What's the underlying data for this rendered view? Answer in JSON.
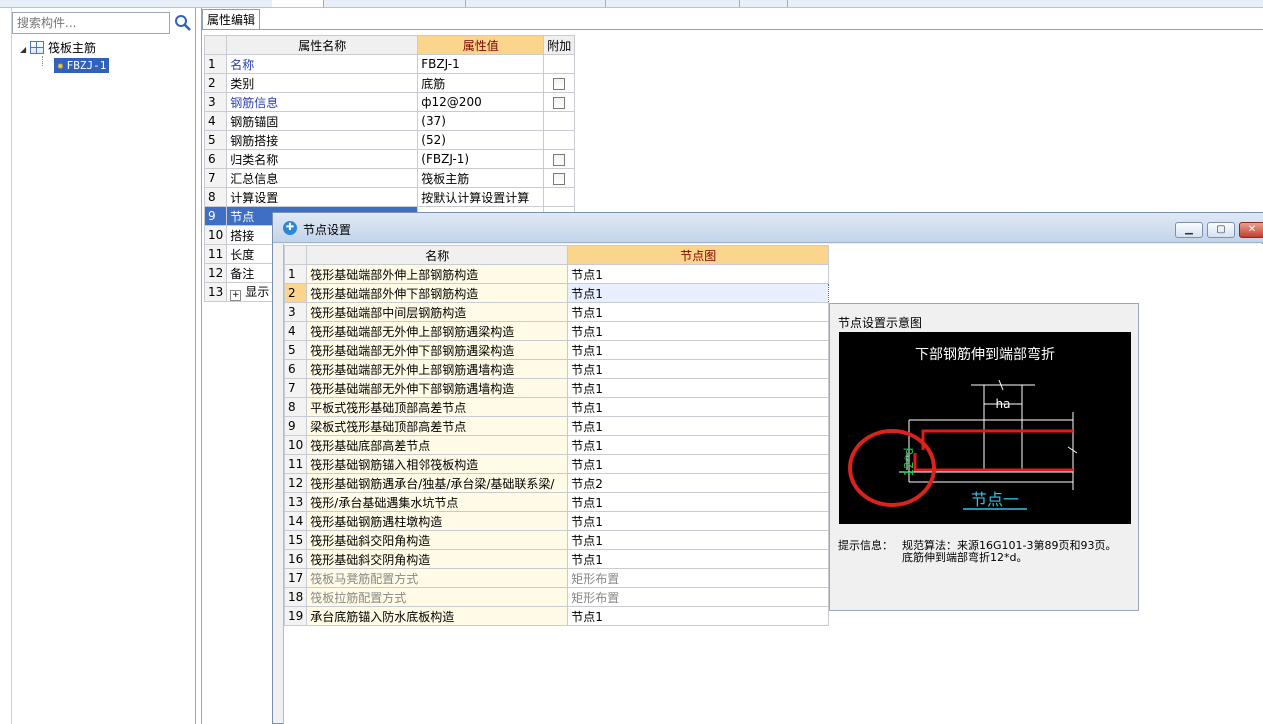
{
  "left": {
    "search_placeholder": "搜索构件...",
    "tree": {
      "parent": "筏板主筋",
      "child": "FBZJ-1"
    }
  },
  "property_panel": {
    "tab": "属性编辑",
    "headers": {
      "name": "属性名称",
      "value": "属性值",
      "extra": "附加"
    },
    "rows": [
      {
        "no": "1",
        "name": "名称",
        "value": "FBZJ-1",
        "checkbox": false
      },
      {
        "no": "2",
        "name": "类别",
        "value": "底筋",
        "checkbox": true
      },
      {
        "no": "3",
        "name": "钢筋信息",
        "value": "ф12@200",
        "checkbox": true
      },
      {
        "no": "4",
        "name": "钢筋锚固",
        "value": "(37)",
        "checkbox": false
      },
      {
        "no": "5",
        "name": "钢筋搭接",
        "value": "(52)",
        "checkbox": false
      },
      {
        "no": "6",
        "name": "归类名称",
        "value": "(FBZJ-1)",
        "checkbox": true
      },
      {
        "no": "7",
        "name": "汇总信息",
        "value": "筏板主筋",
        "checkbox": true
      },
      {
        "no": "8",
        "name": "计算设置",
        "value": "按默认计算设置计算",
        "checkbox": false
      },
      {
        "no": "9",
        "name": "节点",
        "value": "",
        "checkbox": false
      },
      {
        "no": "10",
        "name": "搭接",
        "value": "",
        "checkbox": false
      },
      {
        "no": "11",
        "name": "长度",
        "value": "",
        "checkbox": false
      },
      {
        "no": "12",
        "name": "备注",
        "value": "",
        "checkbox": false
      },
      {
        "no": "13",
        "name": "显示",
        "value": "",
        "checkbox": false
      }
    ]
  },
  "dialog": {
    "title": "节点设置",
    "headers": {
      "name": "名称",
      "pic": "节点图"
    },
    "rows": [
      {
        "no": "1",
        "name": "筏形基础端部外伸上部钢筋构造",
        "value": "节点1"
      },
      {
        "no": "2",
        "name": "筏形基础端部外伸下部钢筋构造",
        "value": "节点1"
      },
      {
        "no": "3",
        "name": "筏形基础端部中间层钢筋构造",
        "value": "节点1"
      },
      {
        "no": "4",
        "name": "筏形基础端部无外伸上部钢筋遇梁构造",
        "value": "节点1"
      },
      {
        "no": "5",
        "name": "筏形基础端部无外伸下部钢筋遇梁构造",
        "value": "节点1"
      },
      {
        "no": "6",
        "name": "筏形基础端部无外伸上部钢筋遇墙构造",
        "value": "节点1"
      },
      {
        "no": "7",
        "name": "筏形基础端部无外伸下部钢筋遇墙构造",
        "value": "节点1"
      },
      {
        "no": "8",
        "name": "平板式筏形基础顶部高差节点",
        "value": "节点1"
      },
      {
        "no": "9",
        "name": "梁板式筏形基础顶部高差节点",
        "value": "节点1"
      },
      {
        "no": "10",
        "name": "筏形基础底部高差节点",
        "value": "节点1"
      },
      {
        "no": "11",
        "name": "筏形基础钢筋锚入相邻筏板构造",
        "value": "节点1"
      },
      {
        "no": "12",
        "name": "筏形基础钢筋遇承台/独基/承台梁/基础联系梁/",
        "value": "节点2"
      },
      {
        "no": "13",
        "name": "筏形/承台基础遇集水坑节点",
        "value": "节点1"
      },
      {
        "no": "14",
        "name": "筏形基础钢筋遇柱墩构造",
        "value": "节点1"
      },
      {
        "no": "15",
        "name": "筏形基础斜交阳角构造",
        "value": "节点1"
      },
      {
        "no": "16",
        "name": "筏形基础斜交阴角构造",
        "value": "节点1"
      },
      {
        "no": "17",
        "name": "筏板马凳筋配置方式",
        "value": "矩形布置"
      },
      {
        "no": "18",
        "name": "筏板拉筋配置方式",
        "value": "矩形布置"
      },
      {
        "no": "19",
        "name": "承台底筋锚入防水底板构造",
        "value": "节点1"
      }
    ],
    "preview": {
      "title": "节点设置示意图",
      "diagram_title": "下部钢筋伸到端部弯折",
      "ha_label": "ha",
      "dim_label": "12*d",
      "node_label": "节点一",
      "hint_label": "提示信息：",
      "hint_line1": "规范算法：来源16G101-3第89页和93页。",
      "hint_line2": "底筋伸到端部弯折12*d。"
    },
    "colors": {
      "header_accent": "#fbd58b",
      "rebar_red": "#e11a1a",
      "circle_red": "#d9231c",
      "label_green": "#22c44a",
      "link_cyan": "#2fc4e8"
    }
  }
}
